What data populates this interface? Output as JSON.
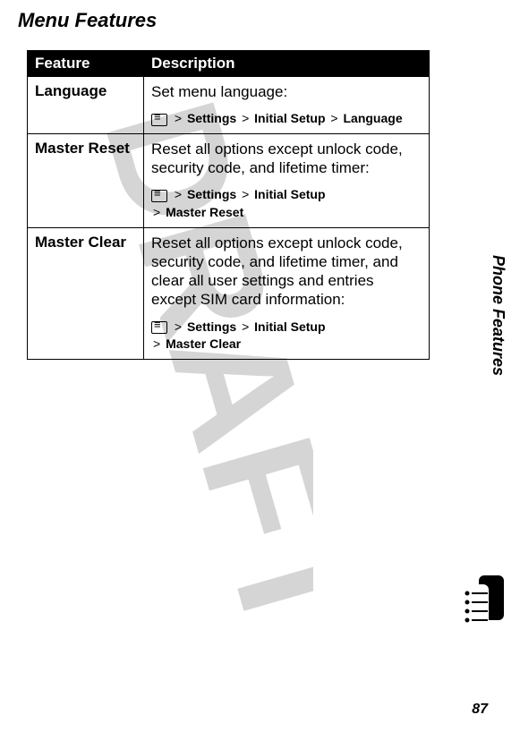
{
  "section_title": "Menu Features",
  "table": {
    "headers": {
      "feature": "Feature",
      "description": "Description"
    },
    "rows": [
      {
        "feature": "Language",
        "description": "Set menu language:",
        "path_line1": {
          "s1": "Settings",
          "s2": "Initial Setup",
          "s3": "Language"
        }
      },
      {
        "feature": "Master Reset",
        "description": "Reset all options except unlock code, security code, and lifetime timer:",
        "path_line1": {
          "s1": "Settings",
          "s2": "Initial Setup"
        },
        "path_line2": {
          "s1": "Master Reset"
        }
      },
      {
        "feature": "Master Clear",
        "description": "Reset all options except unlock code, security code, and lifetime timer, and clear all user settings and entries except SIM card information:",
        "path_line1": {
          "s1": "Settings",
          "s2": "Initial Setup"
        },
        "path_line2": {
          "s1": "Master Clear"
        }
      }
    ]
  },
  "side_label": "Phone Features",
  "page_number": "87",
  "gt": ">"
}
